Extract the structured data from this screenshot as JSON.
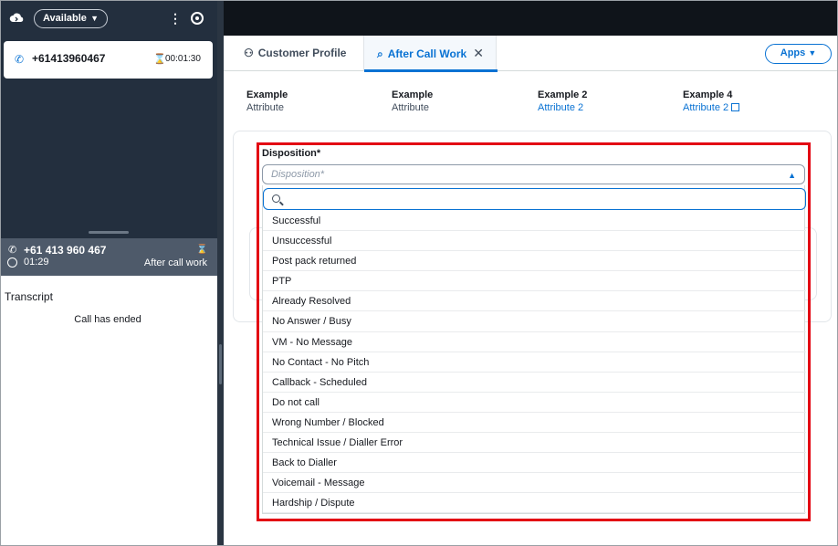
{
  "ccp": {
    "status": "Available",
    "active_call": {
      "number": "+61413960467",
      "timer": "00:01:30"
    },
    "contact": {
      "number": "+61 413 960 467",
      "duration": "01:29",
      "state": "After call work"
    },
    "transcript": {
      "title": "Transcript",
      "message": "Call has ended"
    }
  },
  "workspace": {
    "tabs": [
      {
        "label": "Customer Profile",
        "icon": "person-icon"
      },
      {
        "label": "After Call Work",
        "icon": "speech-bubble-icon",
        "active": true
      }
    ],
    "apps_label": "Apps",
    "attributes": [
      {
        "key": "Example",
        "value": "Attribute",
        "link": false
      },
      {
        "key": "Example",
        "value": "Attribute",
        "link": false
      },
      {
        "key": "Example 2",
        "value": "Attribute 2",
        "link": true
      },
      {
        "key": "Example 4",
        "value": "Attribute 2",
        "link": true,
        "external": true
      }
    ],
    "disposition": {
      "label": "Disposition*",
      "placeholder": "Disposition*",
      "search_placeholder": "",
      "options": [
        "Successful",
        "Unsuccessful",
        "Post pack returned",
        "PTP",
        "Already Resolved",
        "No Answer / Busy",
        "VM - No Message",
        "No Contact - No Pitch",
        "Callback - Scheduled",
        "Do not call",
        "Wrong Number / Blocked",
        "Technical Issue / Dialler Error",
        "Back to Dialler",
        "Voicemail - Message",
        "Hardship / Dispute"
      ]
    }
  },
  "colors": {
    "accent": "#0972d3",
    "highlight": "#e30613",
    "ccp_bg": "#232f3e",
    "contact_bar": "#4e5a6a",
    "topbar": "#0f141a"
  }
}
